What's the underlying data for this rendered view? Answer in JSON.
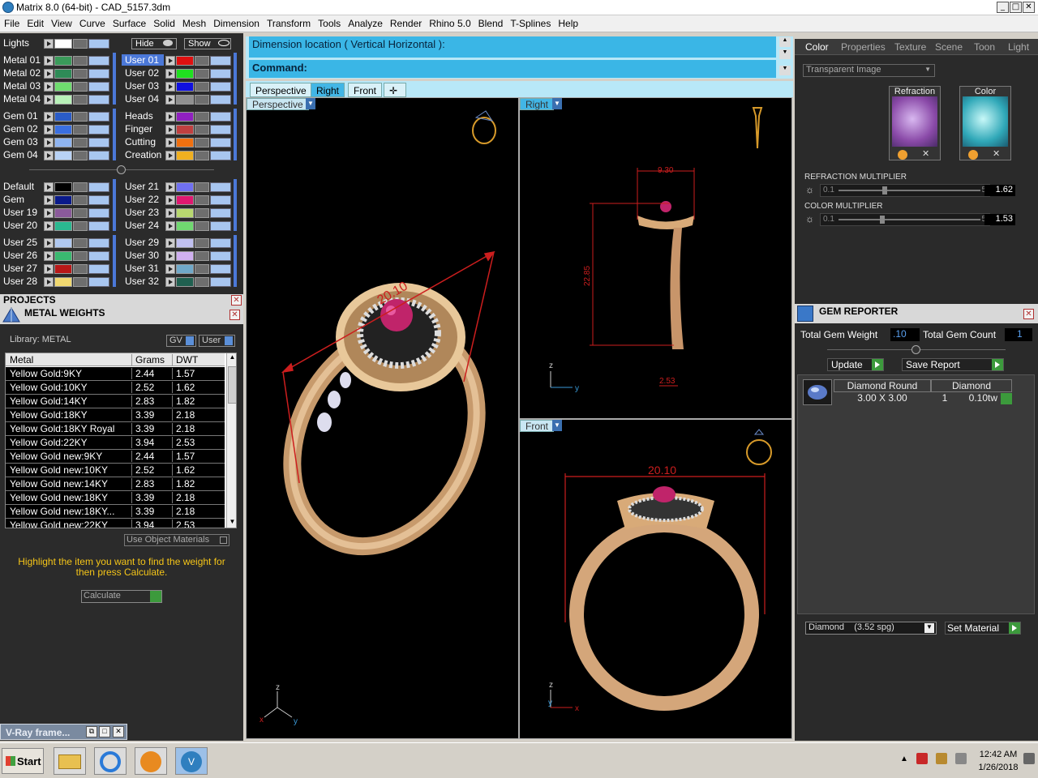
{
  "window": {
    "title": "Matrix 8.0 (64-bit) - CAD_5157.3dm"
  },
  "menu": [
    "File",
    "Edit",
    "View",
    "Curve",
    "Surface",
    "Solid",
    "Mesh",
    "Dimension",
    "Transform",
    "Tools",
    "Analyze",
    "Render",
    "Rhino 5.0",
    "Blend",
    "T-Splines",
    "Help"
  ],
  "layers": {
    "lights_label": "Lights",
    "hide_label": "Hide",
    "show_label": "Show",
    "left": [
      {
        "name": "Metal 01",
        "color": "#3a9a5a"
      },
      {
        "name": "Metal 02",
        "color": "#2e8b57"
      },
      {
        "name": "Metal 03",
        "color": "#6fdc6f"
      },
      {
        "name": "Metal 04",
        "color": "#b8f0b8"
      },
      {
        "name": "Gem 01",
        "color": "#2a5cc8"
      },
      {
        "name": "Gem 02",
        "color": "#3a6fe0"
      },
      {
        "name": "Gem 03",
        "color": "#8fb4f0"
      },
      {
        "name": "Gem 04",
        "color": "#b8d2f5"
      },
      {
        "name": "Default",
        "color": "#000000"
      },
      {
        "name": "Gem",
        "color": "#0a1a8a"
      },
      {
        "name": "User 19",
        "color": "#8a5a9a"
      },
      {
        "name": "User 20",
        "color": "#2ab890"
      },
      {
        "name": "User 25",
        "color": "#b0c8f0"
      },
      {
        "name": "User 26",
        "color": "#3ab870"
      },
      {
        "name": "User 27",
        "color": "#b81818"
      },
      {
        "name": "User 28",
        "color": "#f0d870"
      }
    ],
    "right": [
      {
        "name": "User 01",
        "color": "#e01010"
      },
      {
        "name": "User 02",
        "color": "#20e020"
      },
      {
        "name": "User 03",
        "color": "#1010e0"
      },
      {
        "name": "User 04",
        "color": "#909090"
      },
      {
        "name": "Heads",
        "color": "#9020c0"
      },
      {
        "name": "Finger",
        "color": "#c04040"
      },
      {
        "name": "Cutting",
        "color": "#f07010"
      },
      {
        "name": "Creation",
        "color": "#f0b020"
      },
      {
        "name": "User 21",
        "color": "#7070f0"
      },
      {
        "name": "User 22",
        "color": "#e01870"
      },
      {
        "name": "User 23",
        "color": "#b8d870"
      },
      {
        "name": "User 24",
        "color": "#70d870"
      },
      {
        "name": "User 29",
        "color": "#c0c0f0"
      },
      {
        "name": "User 30",
        "color": "#d0b0f0"
      },
      {
        "name": "User 31",
        "color": "#70a8c8"
      },
      {
        "name": "User 32",
        "color": "#206050"
      }
    ]
  },
  "projects": {
    "label": "PROJECTS"
  },
  "metal_weights": {
    "title": "METAL WEIGHTS",
    "library": "Library: METAL",
    "gv": "GV",
    "user": "User",
    "columns": [
      "Metal",
      "Grams",
      "DWT"
    ],
    "rows": [
      [
        "Yellow Gold:9KY",
        "2.44",
        "1.57"
      ],
      [
        "Yellow Gold:10KY",
        "2.52",
        "1.62"
      ],
      [
        "Yellow Gold:14KY",
        "2.83",
        "1.82"
      ],
      [
        "Yellow Gold:18KY",
        "3.39",
        "2.18"
      ],
      [
        "Yellow Gold:18KY Royal",
        "3.39",
        "2.18"
      ],
      [
        "Yellow Gold:22KY",
        "3.94",
        "2.53"
      ],
      [
        "Yellow Gold new:9KY",
        "2.44",
        "1.57"
      ],
      [
        "Yellow Gold new:10KY",
        "2.52",
        "1.62"
      ],
      [
        "Yellow Gold new:14KY",
        "2.83",
        "1.82"
      ],
      [
        "Yellow Gold new:18KY",
        "3.39",
        "2.18"
      ],
      [
        "Yellow Gold new:18KY...",
        "3.39",
        "2.18"
      ],
      [
        "Yellow Gold new:22KY",
        "3.94",
        "2.53"
      ]
    ],
    "use_object_materials": "Use Object Materials",
    "hint": "Highlight the item you want to find the weight for then press Calculate.",
    "calculate": "Calculate"
  },
  "command": {
    "prompt": "Dimension location ( Vertical  Horizontal ):",
    "label": "Command:"
  },
  "viewport_tabs": [
    "Perspective",
    "Right",
    "Front"
  ],
  "viewports": {
    "perspective": {
      "label": "Perspective",
      "dim": "20.10"
    },
    "right": {
      "label": "Right",
      "dim_top": "9.30",
      "dim_side": "22.85",
      "dim_bottom": "2.53"
    },
    "front": {
      "label": "Front",
      "dim": "20.10"
    }
  },
  "right_tabs": [
    "Color",
    "Properties",
    "Texture",
    "Scene",
    "Toon",
    "Light"
  ],
  "material": {
    "dropdown": "Transparent Image",
    "refraction_label": "Refraction",
    "color_label": "Color",
    "refraction_multiplier": {
      "label": "REFRACTION MULTIPLIER",
      "min": "0.1",
      "max": "5",
      "value": "1.62",
      "level": 0.31
    },
    "color_multiplier": {
      "label": "COLOR MULTIPLIER",
      "min": "0.1",
      "max": "5",
      "value": "1.53",
      "level": 0.29
    }
  },
  "gem_reporter": {
    "title": "GEM REPORTER",
    "total_weight_label": "Total Gem Weight",
    "total_weight": ".10",
    "total_count_label": "Total Gem Count",
    "total_count": "1",
    "update": "Update",
    "save_report": "Save Report",
    "row": {
      "shape": "Diamond Round",
      "material": "Diamond",
      "size": "3.00 X 3.00",
      "qty": "1",
      "weight": "0.10tw"
    },
    "material_select": "Diamond    (3.52 spg)",
    "set_material": "Set Material"
  },
  "vray": {
    "label": "V-Ray frame..."
  },
  "taskbar": {
    "start": "Start",
    "time": "12:42 AM",
    "date": "1/26/2018"
  }
}
